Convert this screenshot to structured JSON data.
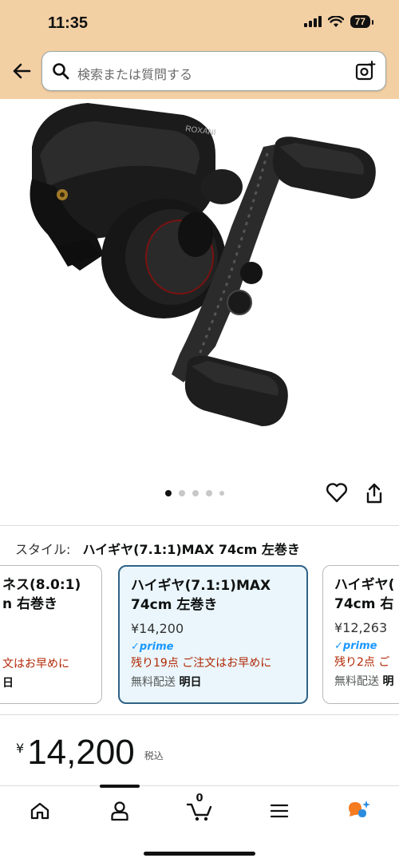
{
  "status_bar": {
    "time": "11:35",
    "battery": "77"
  },
  "search": {
    "placeholder": "検索または質問する"
  },
  "gallery": {
    "image_count": 5,
    "active_index": 0,
    "brand_text": "ROXANI"
  },
  "style": {
    "label": "スタイル:",
    "value": "ハイギヤ(7.1:1)MAX 74cm 左巻き"
  },
  "variants": [
    {
      "name_line1": "ネス(8.0:1)",
      "name_line2": "n 右巻き",
      "price": "",
      "prime": "",
      "stock": "文はお早めに",
      "ship_label": "",
      "ship_value": "日",
      "selected": false
    },
    {
      "name_line1": "ハイギヤ(7.1:1)MAX",
      "name_line2": "74cm 左巻き",
      "price": "¥14,200",
      "prime": "✓prime",
      "stock": "残り19点 ご注文はお早めに",
      "ship_label": "無料配送",
      "ship_value": "明日",
      "selected": true
    },
    {
      "name_line1": "ハイギヤ(",
      "name_line2": "74cm 右",
      "price": "¥12,263",
      "prime": "✓prime",
      "stock": "残り2点 ご",
      "ship_label": "無料配送",
      "ship_value": "明",
      "selected": false
    }
  ],
  "price": {
    "currency": "¥",
    "amount": "14,200",
    "tax": "税込"
  },
  "bottom_nav": {
    "cart_count": "0",
    "active_tab": "account"
  },
  "colors": {
    "header_bg": "#f3cfa4",
    "selected_border": "#2f6287",
    "selected_bg": "#eaf6fb",
    "stock_red": "#b12704",
    "prime_blue": "#1a98ff"
  }
}
